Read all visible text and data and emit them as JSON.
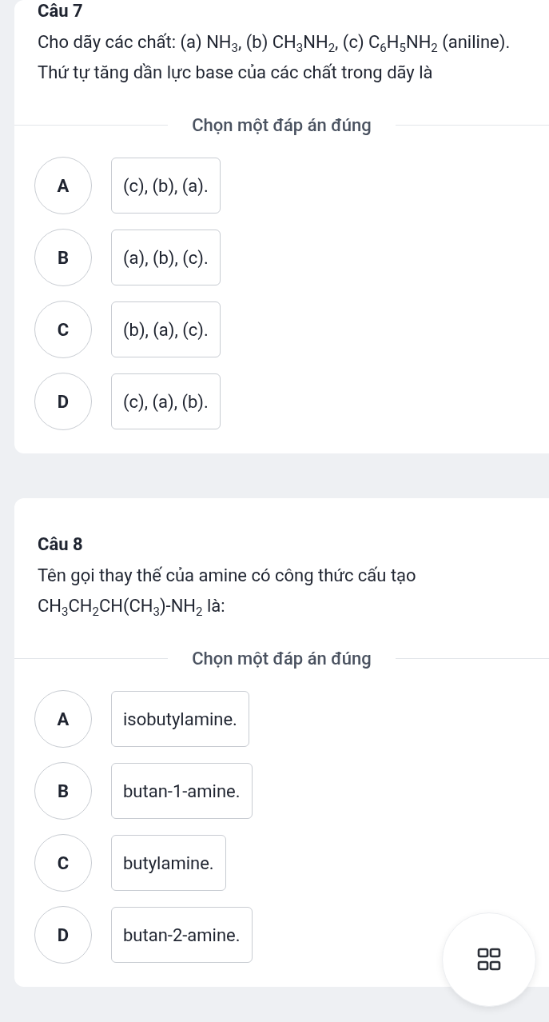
{
  "questions": [
    {
      "title": "Câu 7",
      "text": "Cho dãy các chất: (a) NH$_{3}$, (b) CH$_{3}$NH$_{2}$, (c) C$_{6}$H$_{5}$NH$_{2}$ (aniline). Thứ tự tăng dần lực base của các chất trong dãy là",
      "prompt": "Chọn một đáp án đúng",
      "options": [
        {
          "letter": "A",
          "text": "(c), (b), (a)."
        },
        {
          "letter": "B",
          "text": "(a), (b), (c)."
        },
        {
          "letter": "C",
          "text": "(b), (a), (c)."
        },
        {
          "letter": "D",
          "text": "(c), (a), (b)."
        }
      ]
    },
    {
      "title": "Câu 8",
      "text": "Tên gọi thay thế của amine có công thức cấu tạo CH$_{3}$CH$_{2}$CH(CH$_{3}$)-NH$_{2}$ là:",
      "prompt": "Chọn một đáp án đúng",
      "options": [
        {
          "letter": "A",
          "text": "isobutylamine."
        },
        {
          "letter": "B",
          "text": "butan-1-amine."
        },
        {
          "letter": "C",
          "text": "butylamine."
        },
        {
          "letter": "D",
          "text": "butan-2-amine."
        }
      ]
    }
  ]
}
